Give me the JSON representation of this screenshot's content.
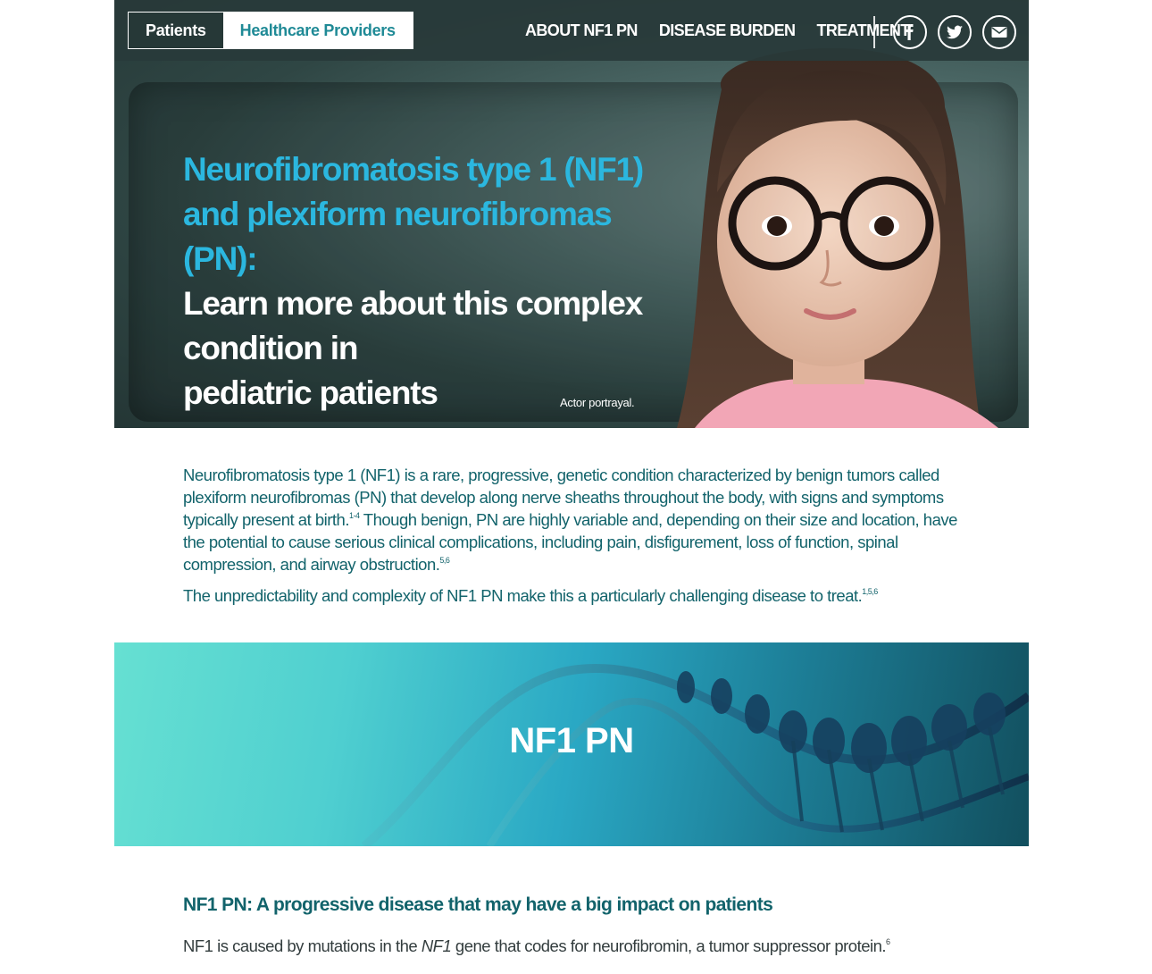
{
  "header": {
    "tabs": [
      {
        "label": "Patients"
      },
      {
        "label": "Healthcare Providers"
      }
    ],
    "nav": [
      {
        "label": "ABOUT NF1 PN"
      },
      {
        "label": "DISEASE BURDEN"
      },
      {
        "label": "TREATMENT"
      }
    ],
    "social": [
      "facebook-icon",
      "twitter-icon",
      "email-icon"
    ]
  },
  "hero": {
    "title_line1": "Neurofibromatosis type 1 (NF1)",
    "title_line2": "and plexiform neurofibromas (PN):",
    "sub_line1": "Learn more about this complex",
    "sub_line2": "condition in",
    "sub_line3": "pediatric patients",
    "caption": "Actor portrayal."
  },
  "intro": {
    "p1_a": "Neurofibromatosis type 1 (NF1) is a rare, progressive, genetic condition characterized by benign tumors called plexiform neurofibromas (PN) that develop along nerve sheaths throughout the body, with signs and symptoms typically present at birth.",
    "p1_ref1": "1-4",
    "p1_b": " Though benign, PN are highly variable and, depending on their size and location, have the potential to cause serious clinical complications, including pain, disfigurement, loss of function, spinal compression, and airway obstruction.",
    "p1_ref2": "5,6",
    "p2": "The unpredictability and complexity of NF1 PN make this a particularly challenging disease to treat.",
    "p2_ref": "1,5,6"
  },
  "banner": {
    "title": "NF1 PN"
  },
  "section": {
    "title": "NF1 PN: A progressive disease that may have a big impact on patients",
    "body_a": "NF1 is caused by mutations in the ",
    "body_italic": "NF1",
    "body_b": " gene that codes for neurofibromin, a tumor suppressor protein.",
    "body_ref": "6"
  },
  "colors": {
    "accent_blue": "#2bb7df",
    "teal_text": "#12636b",
    "hero_dark": "#2f4644"
  }
}
